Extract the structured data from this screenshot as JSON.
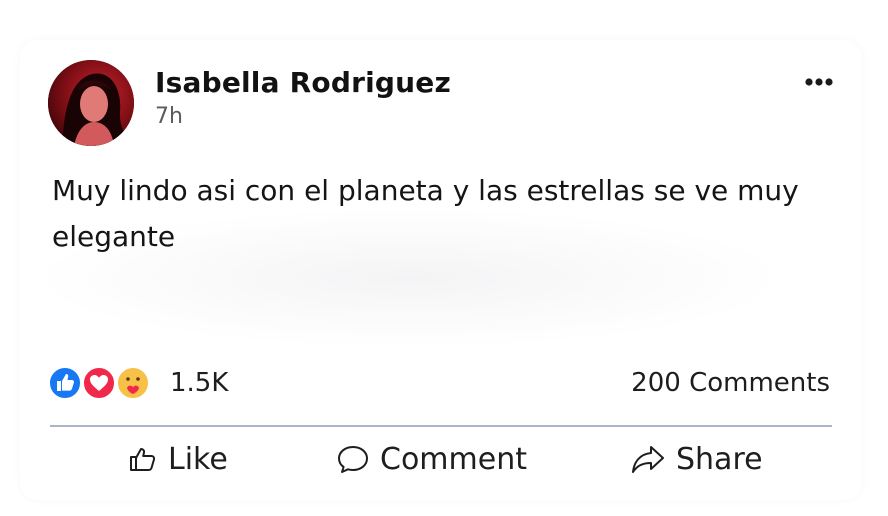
{
  "post": {
    "author": "Isabella Rodriguez",
    "timestamp": "7h",
    "text": "Muy lindo asi con el planeta y las estrellas se ve muy elegante",
    "reactions": {
      "icons": [
        "like-reaction-icon",
        "love-reaction-icon",
        "care-reaction-icon"
      ],
      "count": "1.5K"
    },
    "comments_count": "200 Comments"
  },
  "actions": {
    "like": "Like",
    "comment": "Comment",
    "share": "Share"
  },
  "colors": {
    "like_blue": "#1877f2",
    "love_red": "#f0284a",
    "care_yellow": "#f7c046",
    "divider": "#aab5c6"
  }
}
